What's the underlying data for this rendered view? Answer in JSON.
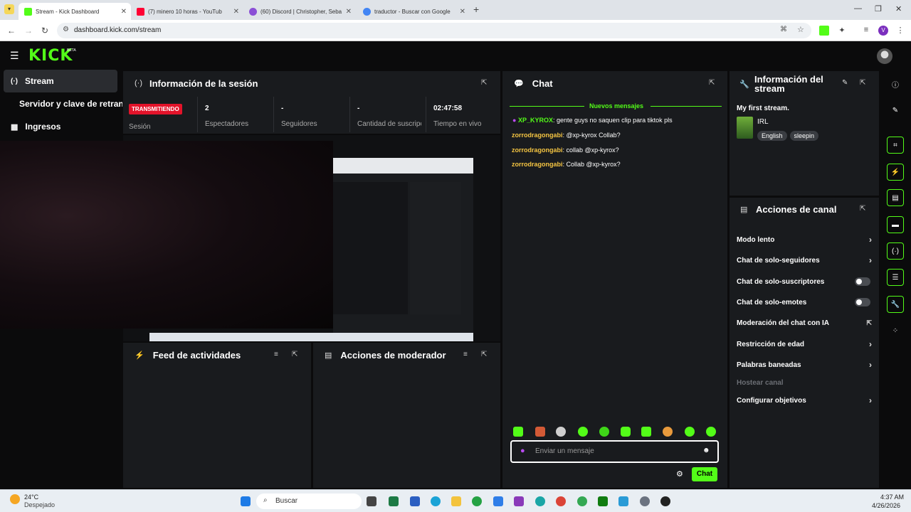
{
  "browser": {
    "tabs": [
      {
        "title": "Stream - Kick Dashboard",
        "favicon_color": "#53fc18",
        "active": true
      },
      {
        "title": "(7) minero 10 horas - YouTub",
        "favicon_color": "#ff0033",
        "active": false
      },
      {
        "title": "(60) Discord | Christopher, Seba",
        "favicon_color": "#8b4fd6",
        "active": false
      },
      {
        "title": "traductor - Buscar con Google",
        "favicon_color": "#4285f4",
        "active": false
      }
    ],
    "new_tab": "+",
    "url": "dashboard.kick.com/stream",
    "profile_initial": "V"
  },
  "app": {
    "logo": "KICK",
    "logo_badge": "BETA",
    "brand_color": "#53fc18"
  },
  "nav": {
    "items": [
      {
        "label": "Stream",
        "icon": "broadcast-icon",
        "active": true
      },
      {
        "label": "Servidor y clave de retransmisión",
        "icon": "",
        "active": false
      },
      {
        "label": "Ingresos",
        "icon": "chart-icon",
        "active": false
      }
    ]
  },
  "session": {
    "title": "Información de la sesión",
    "status": "TRANSMITIENDO",
    "session_label": "Sesión",
    "stats": [
      {
        "value": "2",
        "label": "Espectadores"
      },
      {
        "value": "-",
        "label": "Seguidores"
      },
      {
        "value": "-",
        "label": "Cantidad de suscripciones"
      },
      {
        "value": "02:47:58",
        "label": "Tiempo en vivo"
      }
    ]
  },
  "activity_feed": {
    "title": "Feed de actividades"
  },
  "mod_actions": {
    "title": "Acciones de moderador"
  },
  "chat": {
    "title": "Chat",
    "new_messages": "Nuevos mensajes",
    "messages": [
      {
        "user": "XP_KYROX",
        "user_color": "#53fc18",
        "badge": true,
        "text": "gente guys no saquen clip para tiktok pls"
      },
      {
        "user": "zorrodragongabi",
        "user_color": "#f5c542",
        "badge": false,
        "text": "@xp-kyrox Collab?"
      },
      {
        "user": "zorrodragongabi",
        "user_color": "#f5c542",
        "badge": false,
        "text": "collab @xp-kyrox?"
      },
      {
        "user": "zorrodragongabi",
        "user_color": "#f5c542",
        "badge": false,
        "text": "Collab @xp-kyrox?"
      }
    ],
    "input_placeholder": "Enviar un mensaje",
    "send_label": "Chat"
  },
  "stream_info": {
    "title": "Información del stream",
    "stream_title": "My first stream.",
    "category": "IRL",
    "tags": [
      "English",
      "sleepin"
    ]
  },
  "channel_actions": {
    "title": "Acciones de canal",
    "items": [
      {
        "label": "Modo lento",
        "control": "chevron"
      },
      {
        "label": "Chat de solo-seguidores",
        "control": "chevron"
      },
      {
        "label": "Chat de solo-suscriptores",
        "control": "toggle"
      },
      {
        "label": "Chat de solo-emotes",
        "control": "toggle"
      },
      {
        "label": "Moderación del chat con IA",
        "control": "external"
      },
      {
        "label": "Restricción de edad",
        "control": "chevron"
      },
      {
        "label": "Palabras baneadas",
        "control": "chevron"
      },
      {
        "label": "Hostear canal",
        "control": "disabled"
      },
      {
        "label": "Configurar objetivos",
        "control": "chevron"
      }
    ]
  },
  "taskbar": {
    "weather_temp": "24°C",
    "weather_desc": "Despejado",
    "search_label": "Buscar",
    "time": "4:37 AM",
    "date": "4/26/2026"
  }
}
